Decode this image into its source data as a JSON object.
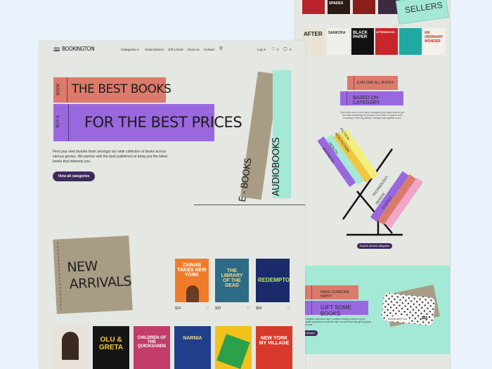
{
  "brand": "BOOKINGTON",
  "nav": {
    "categories": "Categories",
    "subscriptions": "Subscriptions",
    "gift": "Gift a book",
    "about": "About us",
    "contact": "Contact",
    "login": "Log in",
    "wishlist_count": "0",
    "cart_count": "0"
  },
  "hero": {
    "spine1": "BOOK",
    "line1": "THE BEST BOOKS",
    "spine2": "BUY A",
    "line2": "FOR THE BEST PRICES",
    "description": "Find your next favorite book amongst our wide collection of books across various genres. We partner with the best publishers to bring you the latest books that interests you.",
    "cta": "View all categories",
    "ebooks": "E - BOOKS",
    "audiobooks": "AUDIOBOOKS"
  },
  "new_arrivals": {
    "title_line1": "NEW",
    "title_line2": "ARRIVALS",
    "books": [
      {
        "title": "ZAINAB TAKES NEW YORK",
        "price": "$24"
      },
      {
        "title": "THE LIBRARY OF THE DEAD",
        "price": "$30"
      },
      {
        "title": "REDEMPTOR",
        "price": "$68"
      }
    ]
  },
  "bottom_row": [
    "",
    "OLU & GRETA",
    "CHILDREN OF THE QUICKSANDS",
    "NARNIA",
    "",
    "NEW YORK MY VILLAGE"
  ],
  "right_top_row": [
    "",
    "SPADES",
    "",
    ""
  ],
  "right_row2": [
    {
      "title": "AFTER",
      "price": "",
      "color": "#e9e2d5"
    },
    {
      "title": "SANKOFA",
      "price": "",
      "color": "#f0efe9"
    },
    {
      "title": "BLACK PAPER",
      "price": "",
      "color": "#111111"
    },
    {
      "title": "AFTERSHOCKS",
      "price": "",
      "color": "#c8262a"
    },
    {
      "title": "",
      "price": "",
      "color": "#1fa9a2"
    },
    {
      "title": "AN ORDINARY WONDER",
      "price": "",
      "color": "#f3f1ea"
    }
  ],
  "sellers_card": "SELLERS",
  "explore": {
    "line1": "EXPLORE ALL BOOKS",
    "line2": "BASED ON CATEGORY",
    "description": "Our books cover a lot of genre categories that might interest you. We have everything for everyone, from fiction to gather more knowledge. Start by picking a category that appeals to you.",
    "categories_left": [
      "FICTION",
      "NON-FICTION",
      "HEALTH",
      "BUSINESS"
    ],
    "categories_right": [
      "TECHNOLOGY",
      "DESIGN",
      "SCIENCE"
    ],
    "cta": "Explore all book categories"
  },
  "gift": {
    "line1": "MAKE SOMEONE HAPPY",
    "line2": "GIFT SOME BOOKS",
    "description": "Looking to brighten someone's day? Consider sharing a book in a love language, since sometimes a book can open up more than any gift by giving them a new book.",
    "cta": "Send a giftcard",
    "card_brand": "BOOKINGTON",
    "card_value": "$25"
  },
  "colors": {
    "salmon": "#dc7a6c",
    "purple": "#9a68de",
    "mint": "#a4e8d6",
    "khaki": "#a99c85",
    "page": "#e4e7e2",
    "button": "#3f2a5c"
  }
}
